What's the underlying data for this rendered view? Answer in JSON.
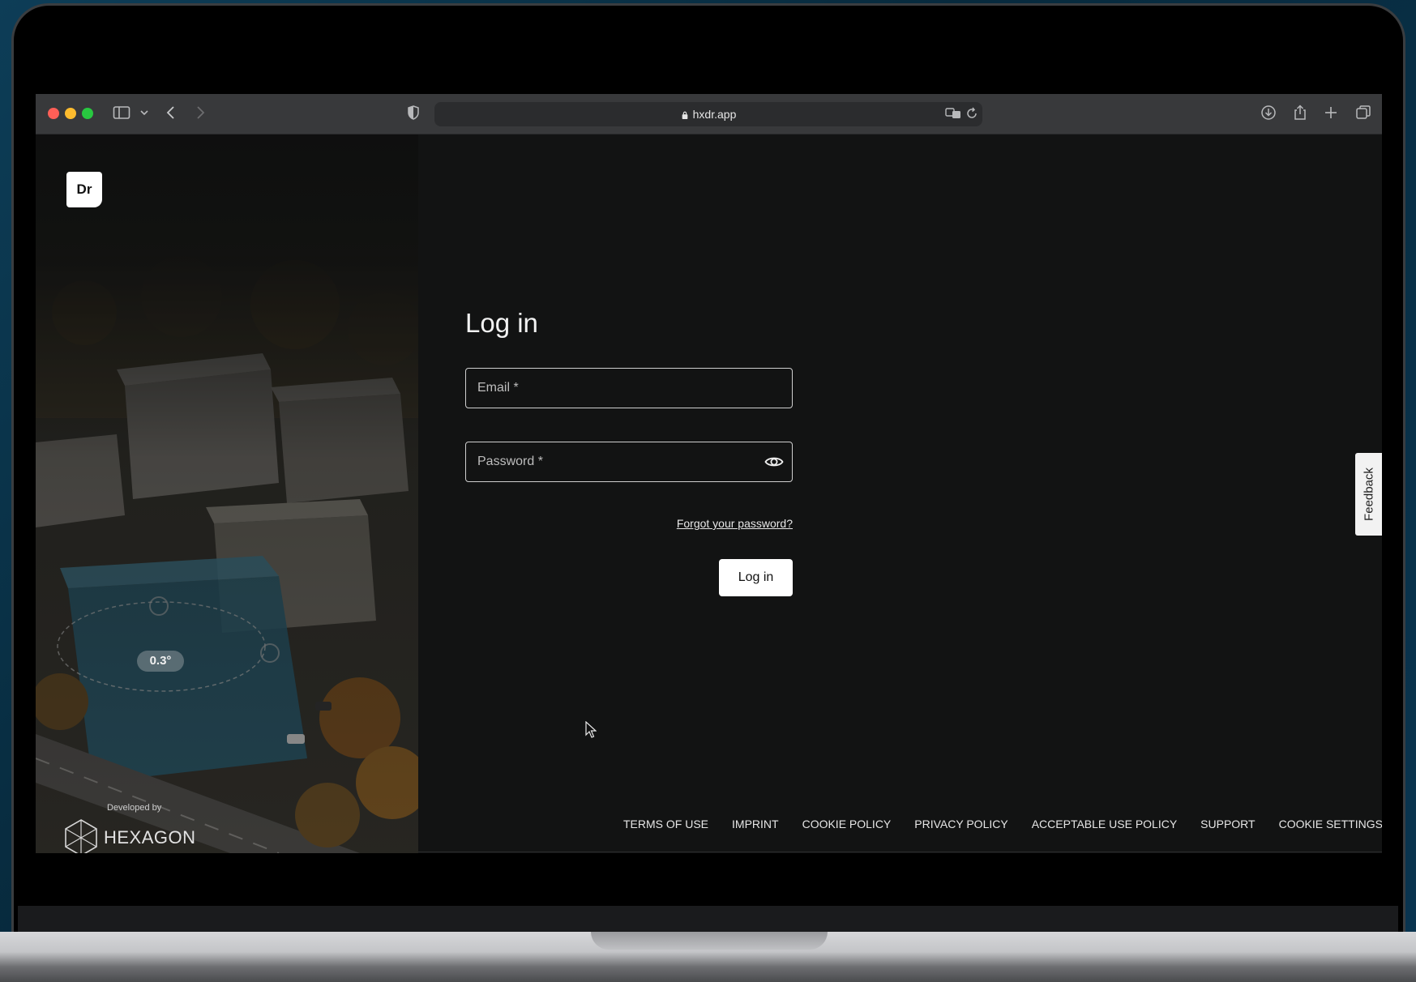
{
  "browser": {
    "url": "hxdr.app"
  },
  "brand": {
    "logo_text": "Dr",
    "developed_by": "Developed by",
    "company": "HEXAGON",
    "overlay_angle": "0.3°"
  },
  "login": {
    "title": "Log in",
    "email_placeholder": "Email *",
    "password_placeholder": "Password *",
    "forgot_link": "Forgot your password?",
    "submit_label": "Log in"
  },
  "feedback": {
    "label": "Feedback"
  },
  "footer": {
    "links": [
      "TERMS OF USE",
      "IMPRINT",
      "COOKIE POLICY",
      "PRIVACY POLICY",
      "ACCEPTABLE USE POLICY",
      "SUPPORT",
      "COOKIE SETTINGS"
    ]
  },
  "colors": {
    "page_background": "#121313",
    "button_background": "#ffffff",
    "toolbar": "#38393b"
  }
}
